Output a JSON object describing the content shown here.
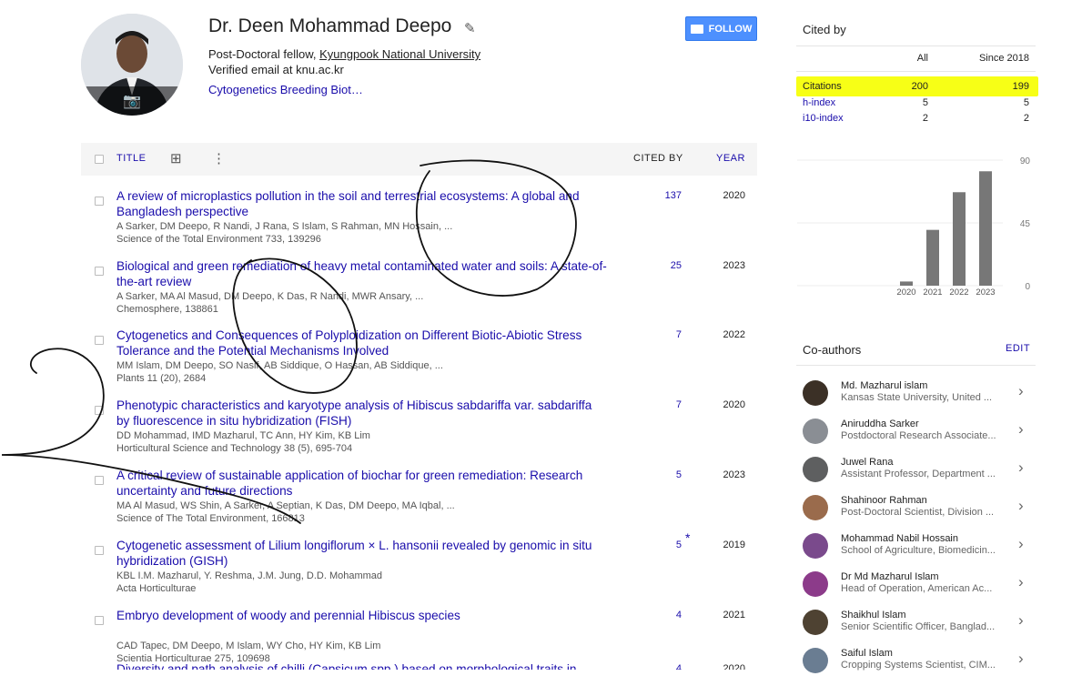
{
  "profile": {
    "name": "Dr. Deen Mohammad Deepo",
    "position": "Post-Doctoral fellow, ",
    "institution": "Kyungpook National University",
    "email": "Verified email at knu.ac.kr",
    "interests": "Cytogenetics Breeding Biot…",
    "follow_label": "FOLLOW"
  },
  "table": {
    "col_title": "TITLE",
    "col_cited": "CITED BY",
    "col_year": "YEAR"
  },
  "articles": [
    {
      "title": "A review of microplastics pollution in the soil and terrestrial ecosystems: A global and Bangladesh perspective",
      "authors": "A Sarker, DM Deepo, R Nandi, J Rana, S Islam, S Rahman, MN Hossain, ...",
      "venue": "Science of the Total Environment 733, 139296",
      "cites": "137",
      "year": "2020"
    },
    {
      "title": "Biological and green remediation of heavy metal contaminated water and soils: A state-of-the-art review",
      "authors": "A Sarker, MA Al Masud, DM Deepo, K Das, R Nandi, MWR Ansary, ...",
      "venue": "Chemosphere, 138861",
      "cites": "25",
      "year": "2023"
    },
    {
      "title": "Cytogenetics and Consequences of Polyploidization on Different Biotic-Abiotic Stress Tolerance and the Potential Mechanisms Involved",
      "authors": "MM Islam, DM Deepo, SO Nasif, AB Siddique, O Hassan, AB Siddique, ...",
      "venue": "Plants 11 (20), 2684",
      "cites": "7",
      "year": "2022"
    },
    {
      "title": "Phenotypic characteristics and karyotype analysis of Hibiscus sabdariffa var. sabdariffa by fluorescence in situ hybridization (FISH)",
      "authors": "DD Mohammad, IMD Mazharul, TC Ann, HY Kim, KB Lim",
      "venue": "Horticultural Science and Technology 38 (5), 695-704",
      "cites": "7",
      "year": "2020"
    },
    {
      "title": "A critical review of sustainable application of biochar for green remediation: Research uncertainty and future directions",
      "authors": "MA Al Masud, WS Shin, A Sarker, A Septian, K Das, DM Deepo, MA Iqbal, ...",
      "venue": "Science of The Total Environment, 166813",
      "cites": "5",
      "year": "2023"
    },
    {
      "title": "Cytogenetic assessment of Lilium longiflorum ×  L. hansonii revealed by genomic in situ hybridization (GISH)",
      "authors": "KBL I.M. Mazharul, Y. Reshma, J.M. Jung, D.D. Mohammad",
      "venue": "Acta Horticulturae",
      "cites": "5",
      "star": "*",
      "year": "2019"
    },
    {
      "title": "Embryo development of woody and perennial Hibiscus species",
      "authors": "CAD Tapec, DM Deepo, M Islam, WY Cho, HY Kim, KB Lim",
      "venue": "Scientia Horticulturae 275, 109698",
      "cites": "4",
      "year": "2021"
    },
    {
      "title": "Diversity and path analysis of chilli (Capsicum spp.) based on morphological traits in",
      "authors": "",
      "venue": "",
      "cites": "4",
      "year": "2020"
    }
  ],
  "cited_by": {
    "title": "Cited by",
    "col_all": "All",
    "col_since": "Since 2018",
    "rows": [
      {
        "label": "Citations",
        "all": "200",
        "since": "199"
      },
      {
        "label": "h-index",
        "all": "5",
        "since": "5"
      },
      {
        "label": "i10-index",
        "all": "2",
        "since": "2"
      }
    ],
    "highlight_color": "#f7ff16"
  },
  "chart_data": {
    "type": "bar",
    "categories": [
      "2020",
      "2021",
      "2022",
      "2023"
    ],
    "values": [
      3,
      40,
      67,
      82
    ],
    "yticks": [
      0,
      45,
      90
    ],
    "ylim": [
      0,
      90
    ],
    "bar_color": "#777777"
  },
  "coauthors": {
    "title": "Co-authors",
    "edit_label": "EDIT",
    "items": [
      {
        "name": "Md. Mazharul islam",
        "affiliation": "Kansas State University, United ..."
      },
      {
        "name": "Aniruddha Sarker",
        "affiliation": "Postdoctoral Research Associate..."
      },
      {
        "name": "Juwel Rana",
        "affiliation": "Assistant Professor, Department ..."
      },
      {
        "name": "Shahinoor Rahman",
        "affiliation": "Post-Doctoral Scientist, Division ..."
      },
      {
        "name": "Mohammad Nabil Hossain",
        "affiliation": "School of Agriculture, Biomedicin..."
      },
      {
        "name": "Dr Md Mazharul Islam",
        "affiliation": "Head of Operation, American Ac..."
      },
      {
        "name": "Shaikhul Islam",
        "affiliation": "Senior Scientific Officer, Banglad..."
      },
      {
        "name": "Saiful Islam",
        "affiliation": "Cropping Systems Scientist, CIM..."
      }
    ]
  }
}
